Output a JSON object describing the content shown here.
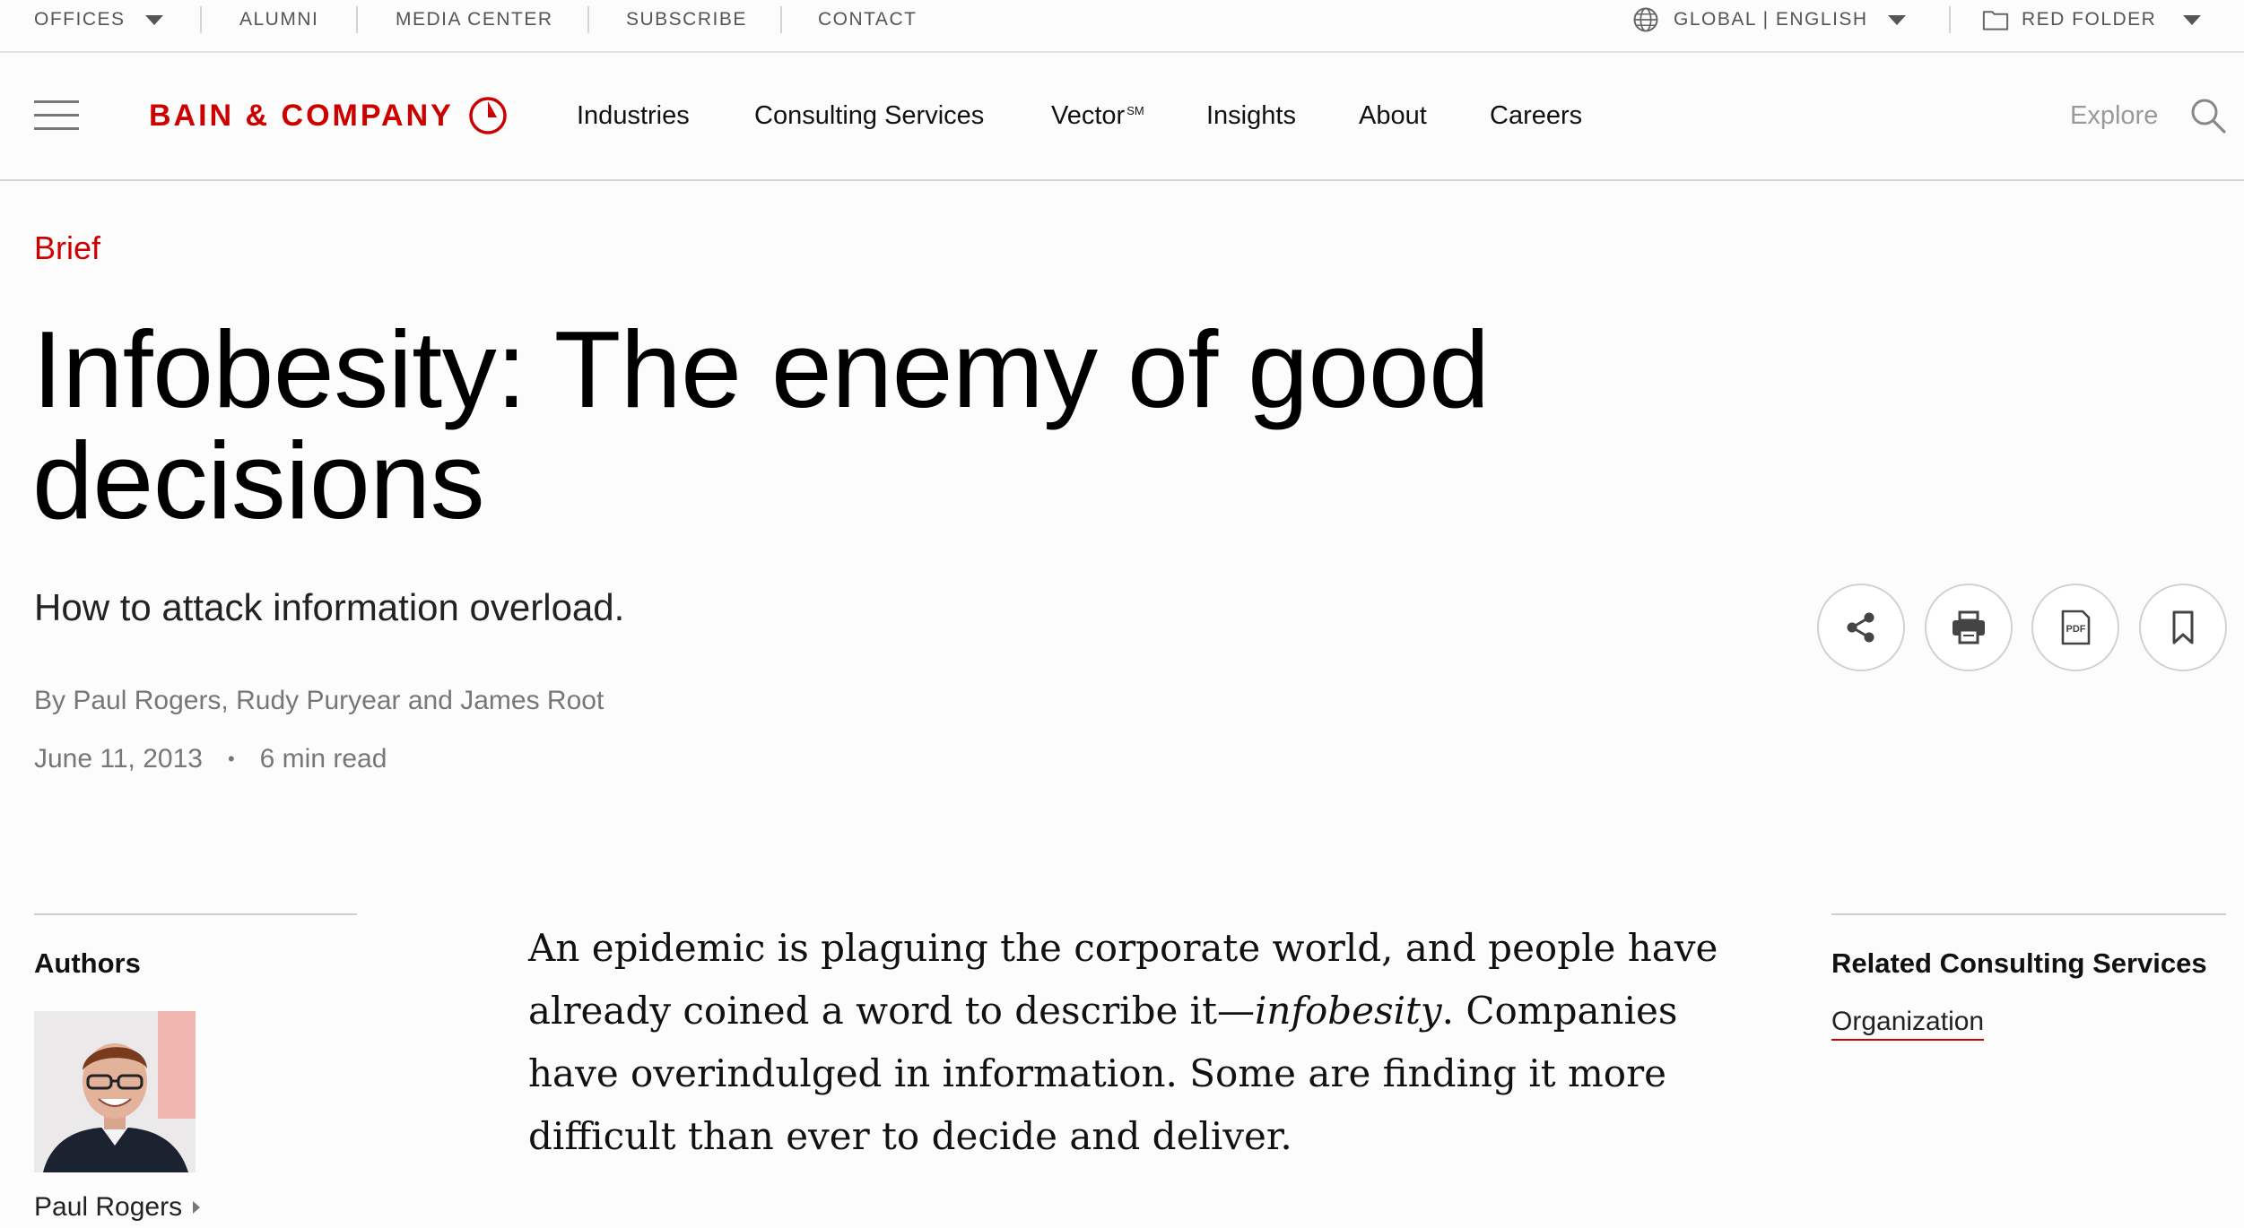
{
  "utility_bar": {
    "offices": "OFFICES",
    "alumni": "ALUMNI",
    "media_center": "MEDIA CENTER",
    "subscribe": "SUBSCRIBE",
    "contact": "CONTACT",
    "region": "GLOBAL | ENGLISH",
    "red_folder": "RED FOLDER"
  },
  "brand": {
    "logo_text": "BAIN & COMPANY",
    "accent_color": "#cc0000"
  },
  "nav": {
    "items": [
      "Industries",
      "Consulting Services",
      "Vector",
      "Insights",
      "About",
      "Careers"
    ],
    "vector_mark": "SM",
    "explore": "Explore"
  },
  "article": {
    "kicker": "Brief",
    "title": "Infobesity: The enemy of good decisions",
    "dek": "How to attack information overload.",
    "byline": "By Paul Rogers, Rudy Puryear and James Root",
    "date": "June 11, 2013",
    "separator": "•",
    "read_time": "6 min read",
    "body_before": "An epidemic is plaguing the corporate world, and people have already coined a word to describe it—",
    "body_term": "infobesity",
    "body_after": ". Companies have overindulged in information. Some are finding it more difficult than ever to decide and deliver."
  },
  "actions": {
    "icons": [
      "share-icon",
      "print-icon",
      "pdf-icon",
      "bookmark-icon"
    ],
    "pdf_label": "PDF"
  },
  "sidebar_left": {
    "heading": "Authors",
    "author_name": "Paul Rogers"
  },
  "sidebar_right": {
    "heading": "Related Consulting Services",
    "link": "Organization"
  }
}
